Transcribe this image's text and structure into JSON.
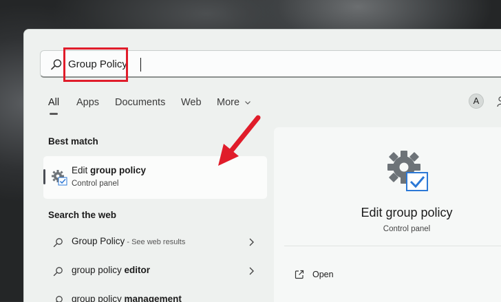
{
  "search": {
    "value": "Group Policy"
  },
  "tabs": [
    {
      "label": "All"
    },
    {
      "label": "Apps"
    },
    {
      "label": "Documents"
    },
    {
      "label": "Web"
    },
    {
      "label": "More"
    }
  ],
  "account": {
    "initial": "A"
  },
  "best_match": {
    "heading": "Best match",
    "title_prefix": "Edit ",
    "title_bold": "group policy",
    "subtitle": "Control panel"
  },
  "web": {
    "heading": "Search the web",
    "items": [
      {
        "text": "Group Policy",
        "bold": "",
        "suffix": " - See web results"
      },
      {
        "text": "group policy ",
        "bold": "editor",
        "suffix": ""
      },
      {
        "text": "group policy ",
        "bold": "management",
        "suffix": ""
      }
    ]
  },
  "preview": {
    "title": "Edit group policy",
    "subtitle": "Control panel",
    "actions": [
      {
        "label": "Open"
      }
    ]
  },
  "colors": {
    "annotation": "#e01c2a",
    "accent": "#2b78d6"
  },
  "icons": [
    "search-icon",
    "chevron-down-icon",
    "gear-icon",
    "checkbox-icon",
    "chevron-right-icon",
    "open-external-icon",
    "overflow-icon"
  ]
}
